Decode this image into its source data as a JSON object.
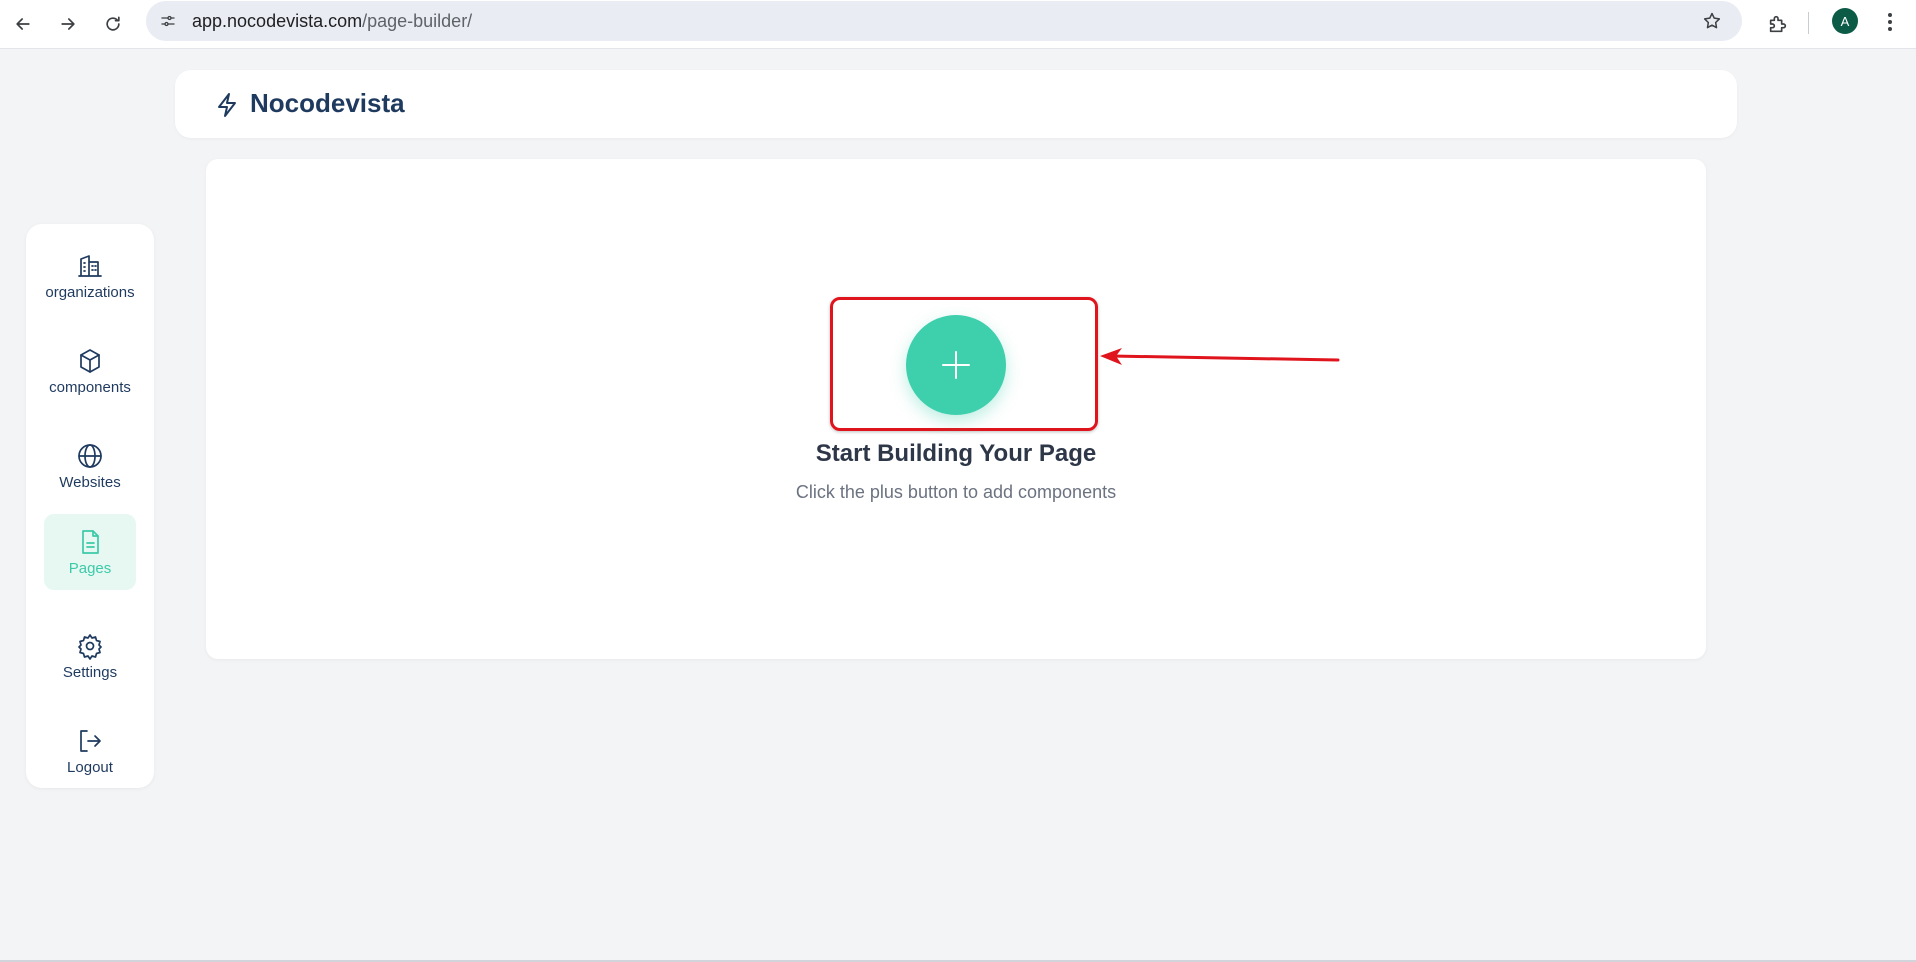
{
  "browser": {
    "url_host": "app.nocodevista.com",
    "url_path": "/page-builder/",
    "profile_initial": "A",
    "icons": [
      "back-arrow-icon",
      "forward-arrow-icon",
      "reload-icon",
      "site-info-icon",
      "star-icon",
      "extensions-icon",
      "more-menu-icon"
    ]
  },
  "header": {
    "brand": "Nocodevista",
    "logo_icon": "lightning-bolt-icon"
  },
  "sidebar": {
    "items": [
      {
        "label": "organizations",
        "icon": "building-icon",
        "active": false
      },
      {
        "label": "components",
        "icon": "cube-icon",
        "active": false
      },
      {
        "label": "Websites",
        "icon": "globe-icon",
        "active": false
      },
      {
        "label": "Pages",
        "icon": "document-icon",
        "active": true
      },
      {
        "label": "Settings",
        "icon": "gear-icon",
        "active": false
      },
      {
        "label": "Logout",
        "icon": "logout-icon",
        "active": false
      }
    ]
  },
  "main": {
    "empty_title": "Start Building Your Page",
    "empty_subtitle": "Click the plus button to add components",
    "add_icon": "plus-icon"
  },
  "colors": {
    "accent": "#3ecfad",
    "active_bg": "#e7f8f3",
    "brand_text": "#1f3a5f",
    "annotation_red": "#e0141c",
    "page_bg": "#f3f4f6"
  }
}
